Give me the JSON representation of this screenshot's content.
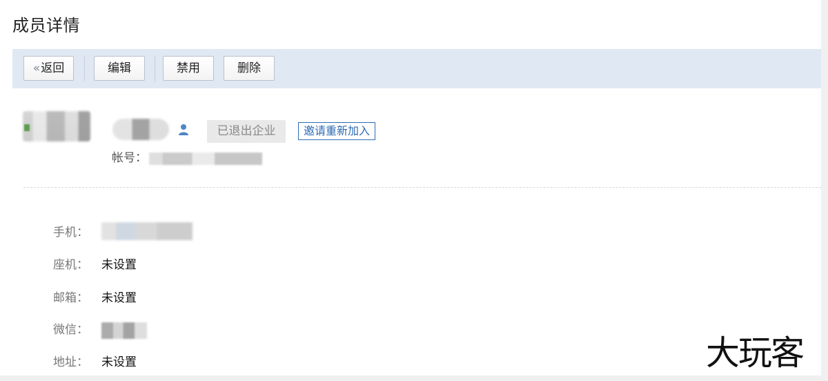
{
  "page": {
    "title": "成员详情"
  },
  "toolbar": {
    "back_label": "返回",
    "edit_label": "编辑",
    "disable_label": "禁用",
    "delete_label": "删除"
  },
  "member": {
    "name": "",
    "status": "已退出企业",
    "invite_label": "邀请重新加入",
    "account_label": "帐号：",
    "account_value": ""
  },
  "details": [
    {
      "label": "手机：",
      "value": ""
    },
    {
      "label": "座机：",
      "value": "未设置"
    },
    {
      "label": "邮箱：",
      "value": "未设置"
    },
    {
      "label": "微信：",
      "value": ""
    },
    {
      "label": "地址：",
      "value": "未设置"
    }
  ],
  "watermark": "大玩客",
  "icons": {
    "back": "double-chevron-left-icon",
    "user": "user-icon"
  },
  "colors": {
    "toolbar_bg": "#e0e8f3",
    "link": "#2d6bb4",
    "badge_bg": "#e9e9e9"
  }
}
